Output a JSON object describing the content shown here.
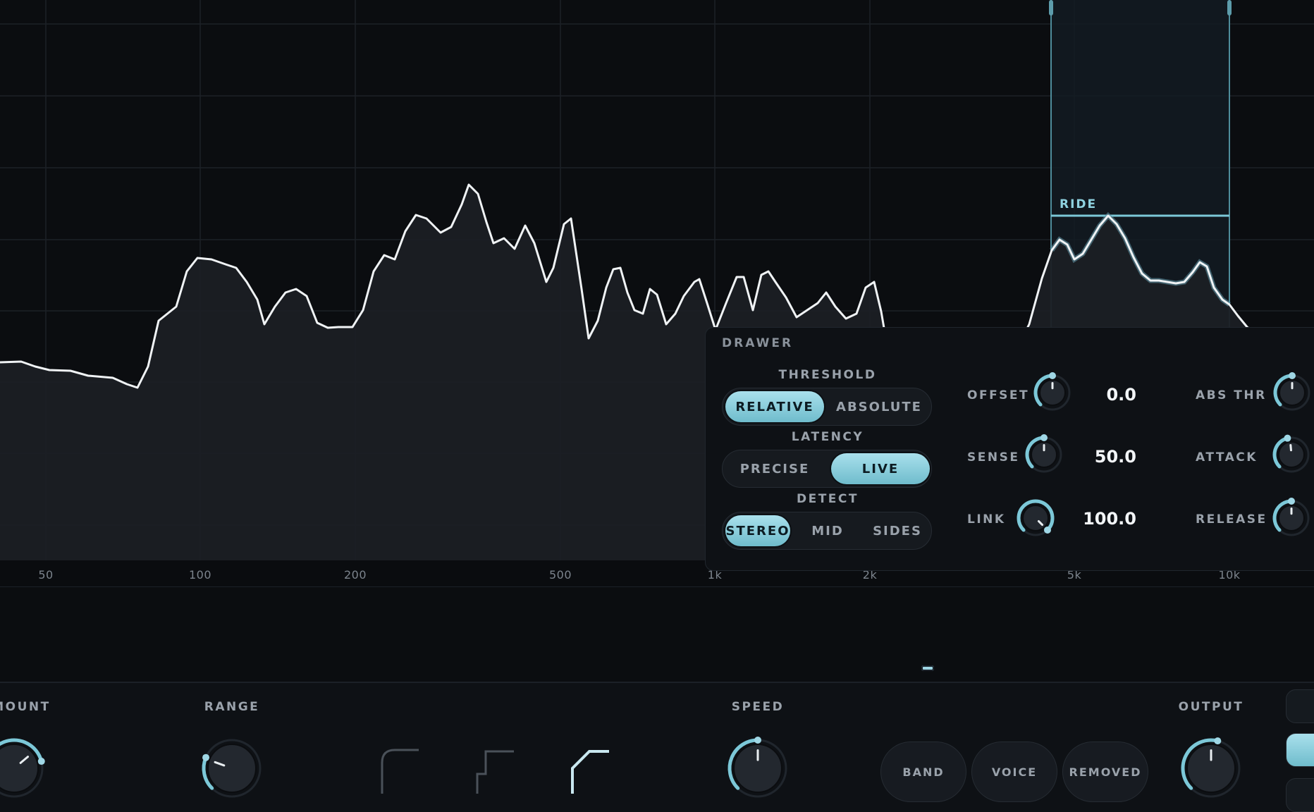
{
  "spectrum": {
    "freq_labels": [
      "50",
      "100",
      "200",
      "500",
      "1k",
      "2k",
      "5k",
      "10k"
    ],
    "ride_band_label": "RIDE"
  },
  "drawer": {
    "title": "DRAWER",
    "threshold": {
      "label": "THRESHOLD",
      "options": [
        "RELATIVE",
        "ABSOLUTE"
      ],
      "selected": "RELATIVE"
    },
    "latency": {
      "label": "LATENCY",
      "options": [
        "PRECISE",
        "LIVE"
      ],
      "selected": "LIVE"
    },
    "detect": {
      "label": "DETECT",
      "options": [
        "STEREO",
        "MID",
        "SIDES"
      ],
      "selected": "STEREO"
    },
    "params": [
      {
        "label": "OFFSET",
        "value": "0.0"
      },
      {
        "label": "SENSE",
        "value": "50.0"
      },
      {
        "label": "LINK",
        "value": "100.0"
      }
    ],
    "params_right": [
      {
        "label": "ABS THR"
      },
      {
        "label": "ATTACK"
      },
      {
        "label": "RELEASE"
      }
    ]
  },
  "bottom": {
    "amount_label": "MOUNT",
    "range_label": "RANGE",
    "speed_label": "SPEED",
    "output_label": "OUTPUT",
    "buttons": [
      "BAND",
      "VOICE",
      "REMOVED"
    ]
  },
  "colors": {
    "accent": "#7cc8d8",
    "background": "#0a0c0f",
    "panel": "#0e1115"
  }
}
